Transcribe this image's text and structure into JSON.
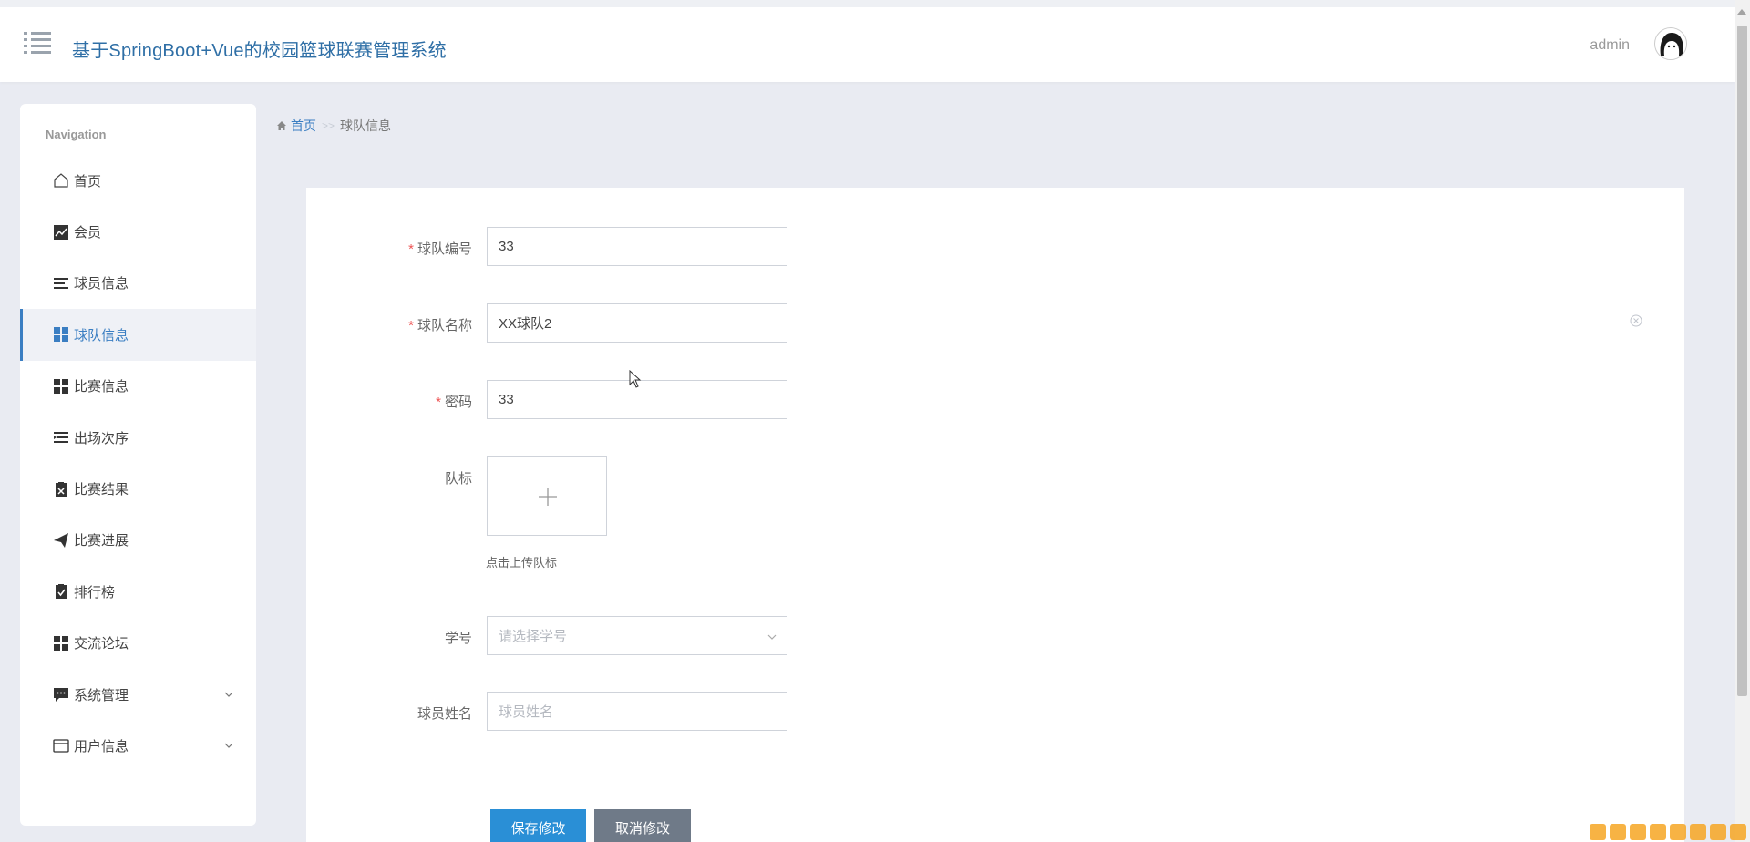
{
  "header": {
    "title": "基于SpringBoot+Vue的校园篮球联赛管理系统",
    "username": "admin"
  },
  "sidebar": {
    "caption": "Navigation",
    "items": [
      {
        "label": "首页",
        "icon": "home-icon"
      },
      {
        "label": "会员",
        "icon": "chart-icon"
      },
      {
        "label": "球员信息",
        "icon": "list-icon"
      },
      {
        "label": "球队信息",
        "icon": "grid-icon",
        "active": true
      },
      {
        "label": "比赛信息",
        "icon": "grid-icon"
      },
      {
        "label": "出场次序",
        "icon": "indent-icon"
      },
      {
        "label": "比赛结果",
        "icon": "clipboard-x-icon"
      },
      {
        "label": "比赛进展",
        "icon": "send-icon"
      },
      {
        "label": "排行榜",
        "icon": "clipboard-check-icon"
      },
      {
        "label": "交流论坛",
        "icon": "grid-icon"
      },
      {
        "label": "系统管理",
        "icon": "comment-icon",
        "expandable": true
      },
      {
        "label": "用户信息",
        "icon": "card-icon",
        "expandable": true
      }
    ]
  },
  "breadcrumb": {
    "home": "首页",
    "separator": ">>",
    "current": "球队信息"
  },
  "form": {
    "team_id": {
      "label": "球队编号",
      "value": "33",
      "required": true
    },
    "team_name": {
      "label": "球队名称",
      "value": "XX球队2",
      "required": true
    },
    "password": {
      "label": "密码",
      "value": "33",
      "required": true
    },
    "logo": {
      "label": "队标",
      "hint": "点击上传队标"
    },
    "student_id": {
      "label": "学号",
      "placeholder": "请选择学号"
    },
    "player_name": {
      "label": "球员姓名",
      "placeholder": "球员姓名"
    },
    "required_mark": "*"
  },
  "buttons": {
    "save": "保存修改",
    "cancel": "取消修改"
  },
  "colors": {
    "accent": "#3a7ec2",
    "save_button": "#2a8fd6",
    "cancel_button": "#6f7a88"
  }
}
